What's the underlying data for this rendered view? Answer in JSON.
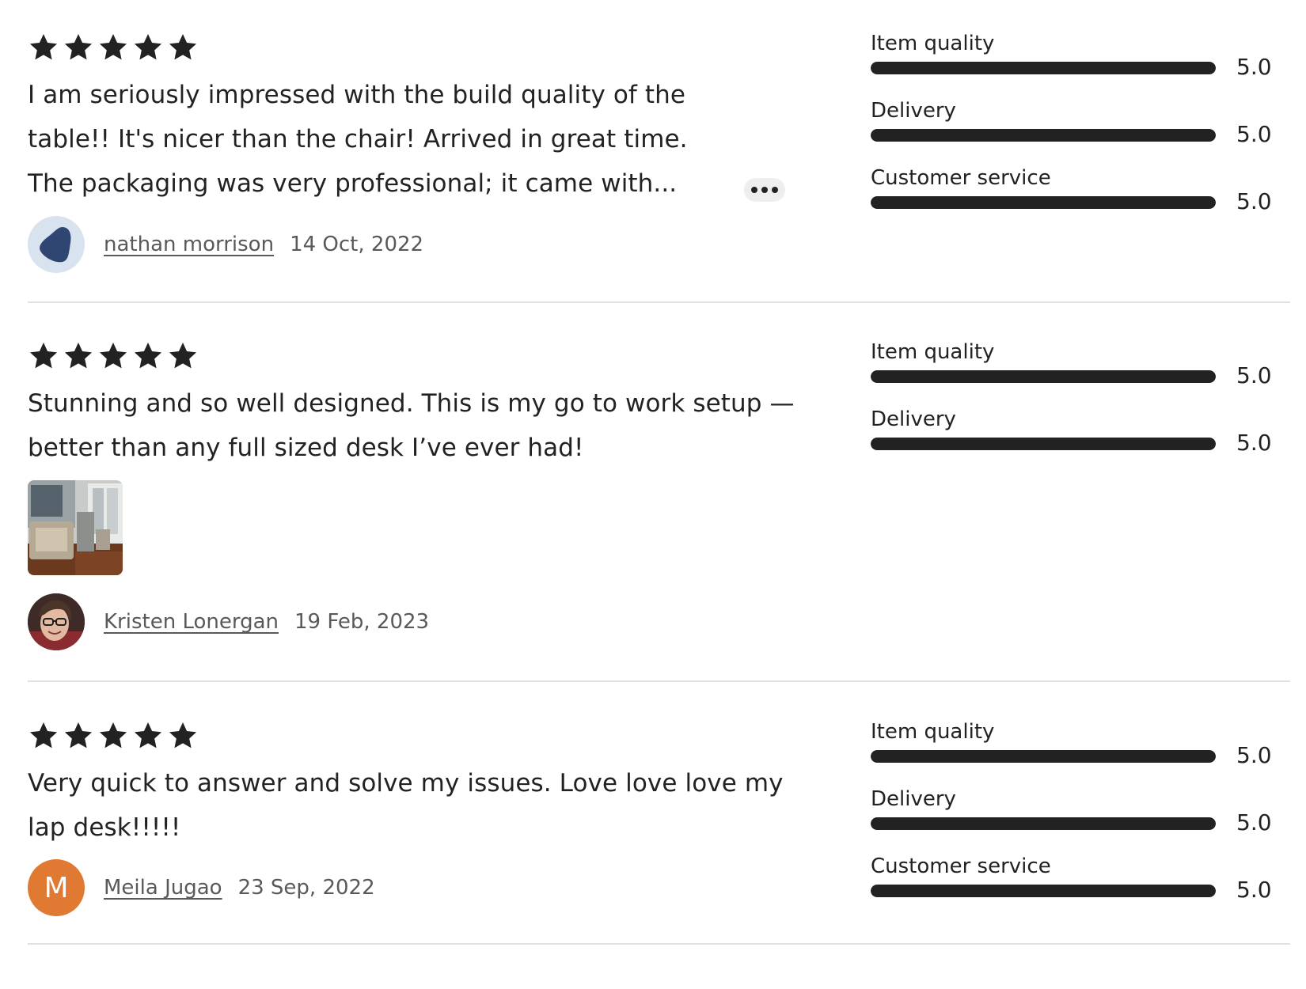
{
  "colors": {
    "text": "#222222",
    "muted": "#595959",
    "divider": "#e1e1e1",
    "bar": "#222222",
    "orange_avatar": "#e07a32"
  },
  "reviews": [
    {
      "stars": 5,
      "text": "I am seriously impressed with the build quality of the table!! It's nicer than the chair! Arrived in great time. The packaging was very professional; it came with...",
      "author": "nathan morrison",
      "date": "14 Oct, 2022",
      "ratings": [
        {
          "label": "Item quality",
          "value": "5.0",
          "fraction": 1.0
        },
        {
          "label": "Delivery",
          "value": "5.0",
          "fraction": 1.0
        },
        {
          "label": "Customer service",
          "value": "5.0",
          "fraction": 1.0
        }
      ]
    },
    {
      "stars": 5,
      "text": "Stunning and so well designed. This is my go to work setup — better than any full sized desk I’ve ever had!",
      "author": "Kristen Lonergan",
      "date": "19 Feb, 2023",
      "ratings": [
        {
          "label": "Item quality",
          "value": "5.0",
          "fraction": 1.0
        },
        {
          "label": "Delivery",
          "value": "5.0",
          "fraction": 1.0
        }
      ]
    },
    {
      "stars": 5,
      "text": "Very quick to answer and solve my issues. Love love love my lap desk!!!!!",
      "author": "Meila Jugao",
      "avatar_initial": "M",
      "date": "23 Sep, 2022",
      "ratings": [
        {
          "label": "Item quality",
          "value": "5.0",
          "fraction": 1.0
        },
        {
          "label": "Delivery",
          "value": "5.0",
          "fraction": 1.0
        },
        {
          "label": "Customer service",
          "value": "5.0",
          "fraction": 1.0
        }
      ]
    }
  ]
}
